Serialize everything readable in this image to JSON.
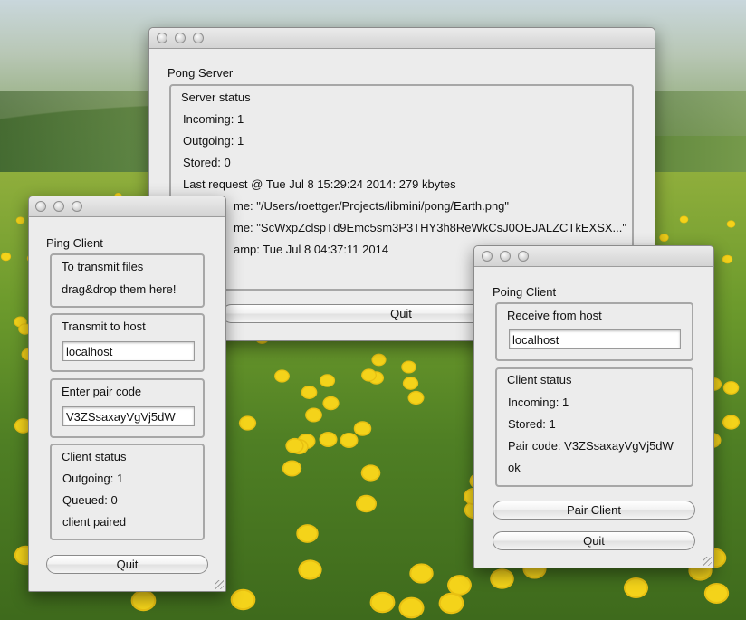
{
  "server": {
    "window_title": "Pong Server",
    "status_title": "Server status",
    "incoming": "Incoming: 1",
    "outgoing": "Outgoing: 1",
    "stored": "Stored: 0",
    "last_request": "Last request @ Tue Jul 8 15:29:24 2014: 279 kbytes",
    "line_name": "me: \"/Users/roettger/Projects/libmini/pong/Earth.png\"",
    "line_short_name": "me: \"ScWxpZclspTd9Emc5sm3P3THY3h8ReWkCsJ0OEJALZCTkEXSX...\"",
    "line_timestamp": "amp: Tue Jul 8 04:37:11 2014",
    "quit_label": "Quit"
  },
  "ping": {
    "window_title": "Ping Client",
    "transmit_line1": "To transmit files",
    "transmit_line2": "drag&drop them here!",
    "host_title": "Transmit to host",
    "host_value": "localhost",
    "pair_title": "Enter pair code",
    "pair_value": "V3ZSsaxayVgVj5dW",
    "status_title": "Client status",
    "outgoing": "Outgoing: 1",
    "queued": "Queued: 0",
    "paired": "client paired",
    "quit_label": "Quit"
  },
  "poing": {
    "window_title": "Poing Client",
    "host_title": "Receive from host",
    "host_value": "localhost",
    "status_title": "Client status",
    "incoming": "Incoming: 1",
    "stored": "Stored: 1",
    "pair_code": "Pair code: V3ZSsaxayVgVj5dW",
    "ok": "ok",
    "pair_button": "Pair Client",
    "quit_label": "Quit"
  }
}
